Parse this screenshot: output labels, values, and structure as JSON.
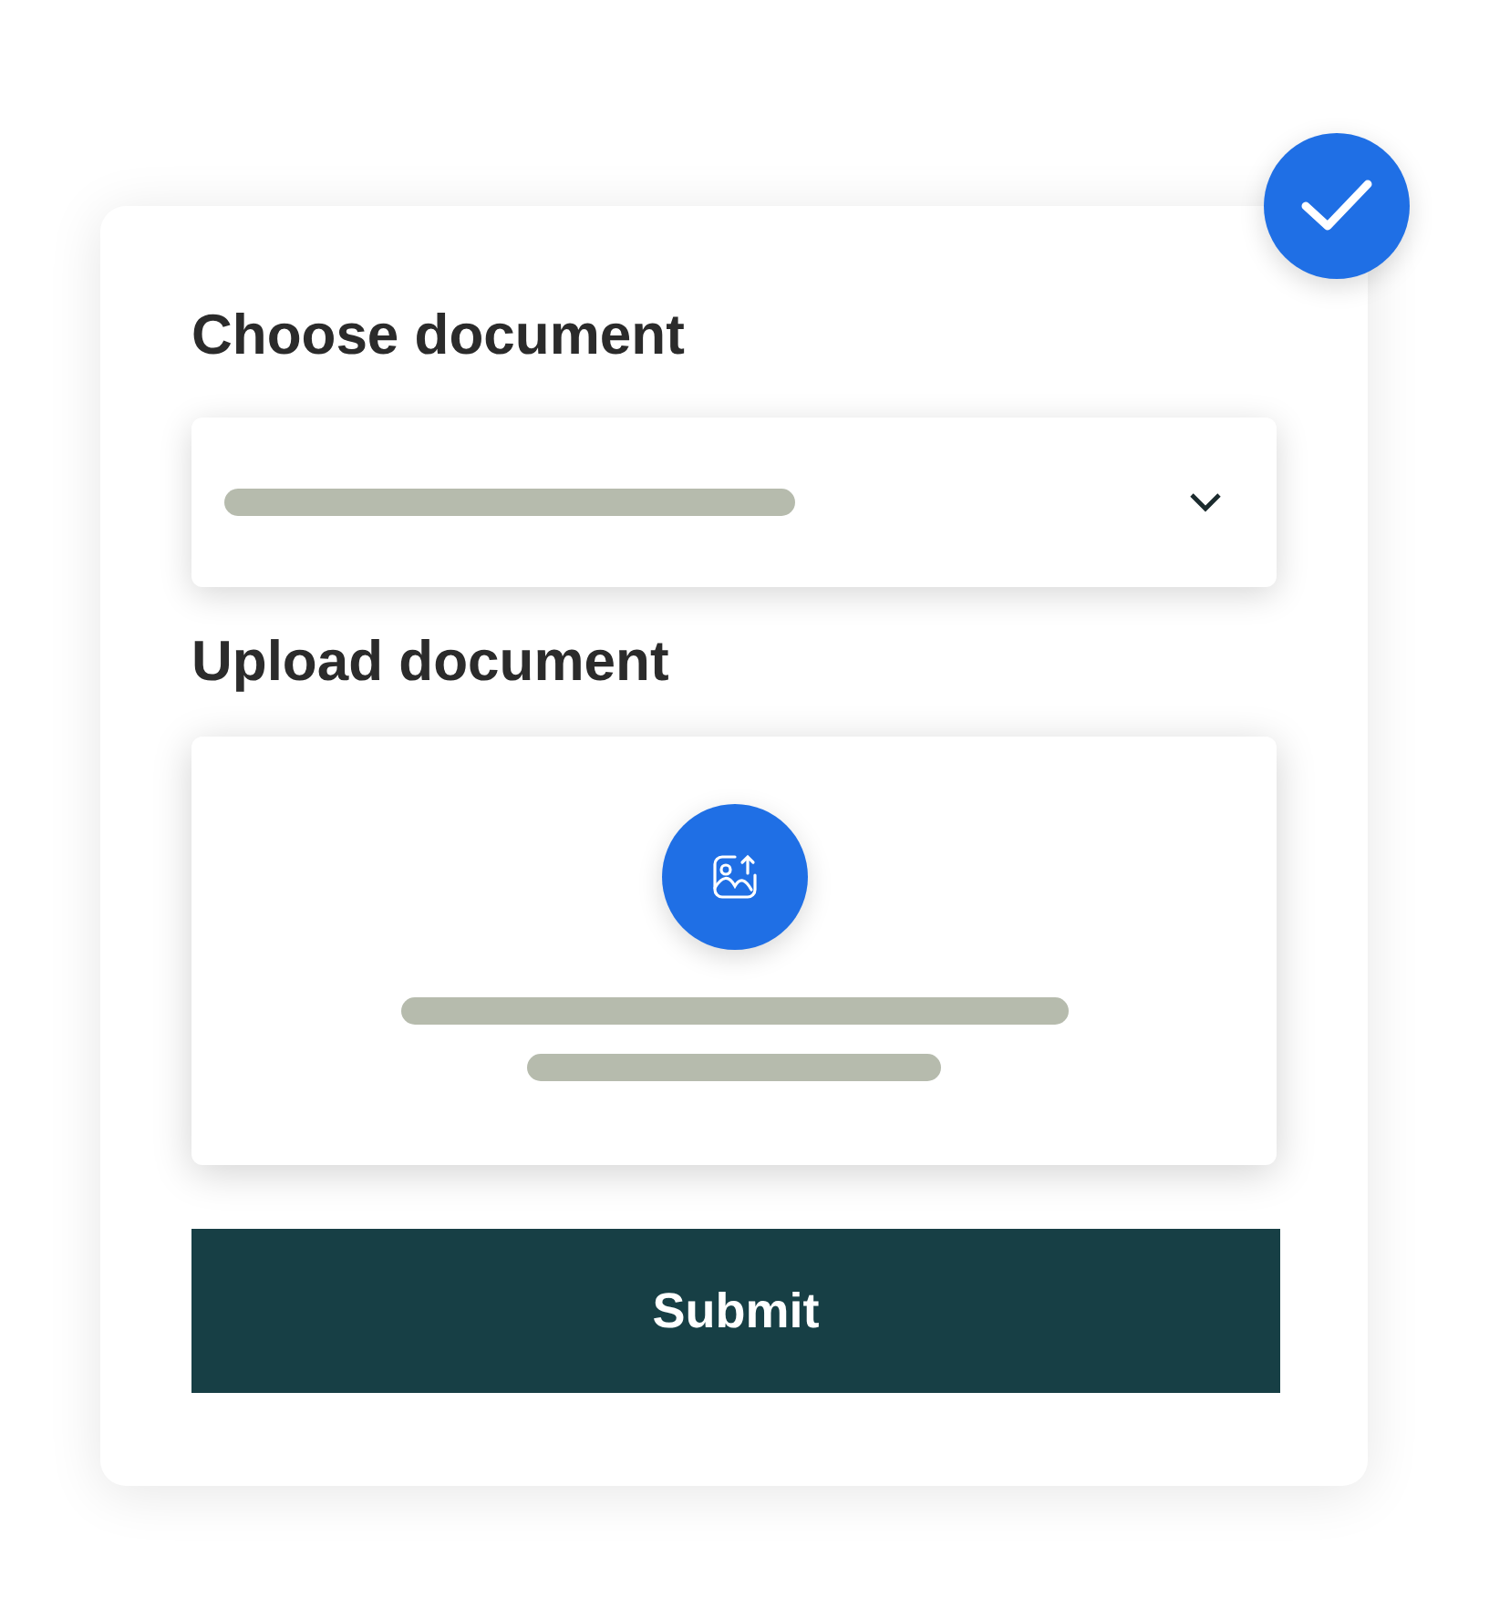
{
  "form": {
    "choose_label": "Choose document",
    "upload_label": "Upload document",
    "submit": "Submit"
  }
}
